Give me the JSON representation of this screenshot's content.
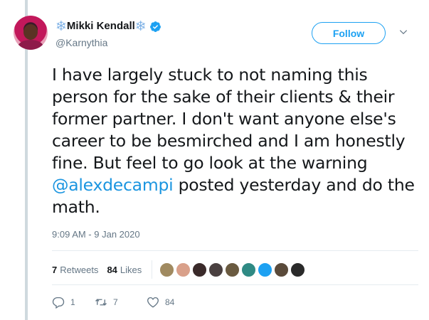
{
  "author": {
    "snow_left": "❄",
    "display_name": "Mikki Kendall",
    "snow_right": "❄",
    "handle": "@Karnythia",
    "verified": true,
    "avatar_icon": "profile-photo"
  },
  "follow_label": "Follow",
  "tweet": {
    "text_before": "I have largely stuck to not naming this person for the sake of their clients & their former partner. I don't want anyone else's career to be besmirched and I am honestly fine. But feel to go look at the warning ",
    "mention": "@alexdecampi",
    "text_after": " posted yesterday and do the math."
  },
  "timestamp": "9:09 AM - 9 Jan 2020",
  "stats": {
    "retweets_count": "7",
    "retweets_label": "Retweets",
    "likes_count": "84",
    "likes_label": "Likes"
  },
  "likers": [
    {
      "icon": "liker-avatar-1",
      "color": "#a08a60"
    },
    {
      "icon": "liker-avatar-2",
      "color": "#d9a08a"
    },
    {
      "icon": "liker-avatar-3",
      "color": "#3a2a2a"
    },
    {
      "icon": "liker-avatar-4",
      "color": "#4a4040"
    },
    {
      "icon": "liker-avatar-5",
      "color": "#6a5a40"
    },
    {
      "icon": "liker-avatar-6",
      "color": "#2f8a84"
    },
    {
      "icon": "liker-avatar-7",
      "color": "#1da1f2"
    },
    {
      "icon": "liker-avatar-8",
      "color": "#5a4a3a"
    },
    {
      "icon": "liker-avatar-9",
      "color": "#2a2a2a"
    }
  ],
  "actions": {
    "reply_count": "1",
    "retweet_count": "7",
    "like_count": "84"
  },
  "colors": {
    "accent": "#1da1f2",
    "mention": "#1b95e0",
    "muted": "#657786",
    "verified": "#1da1f2"
  }
}
